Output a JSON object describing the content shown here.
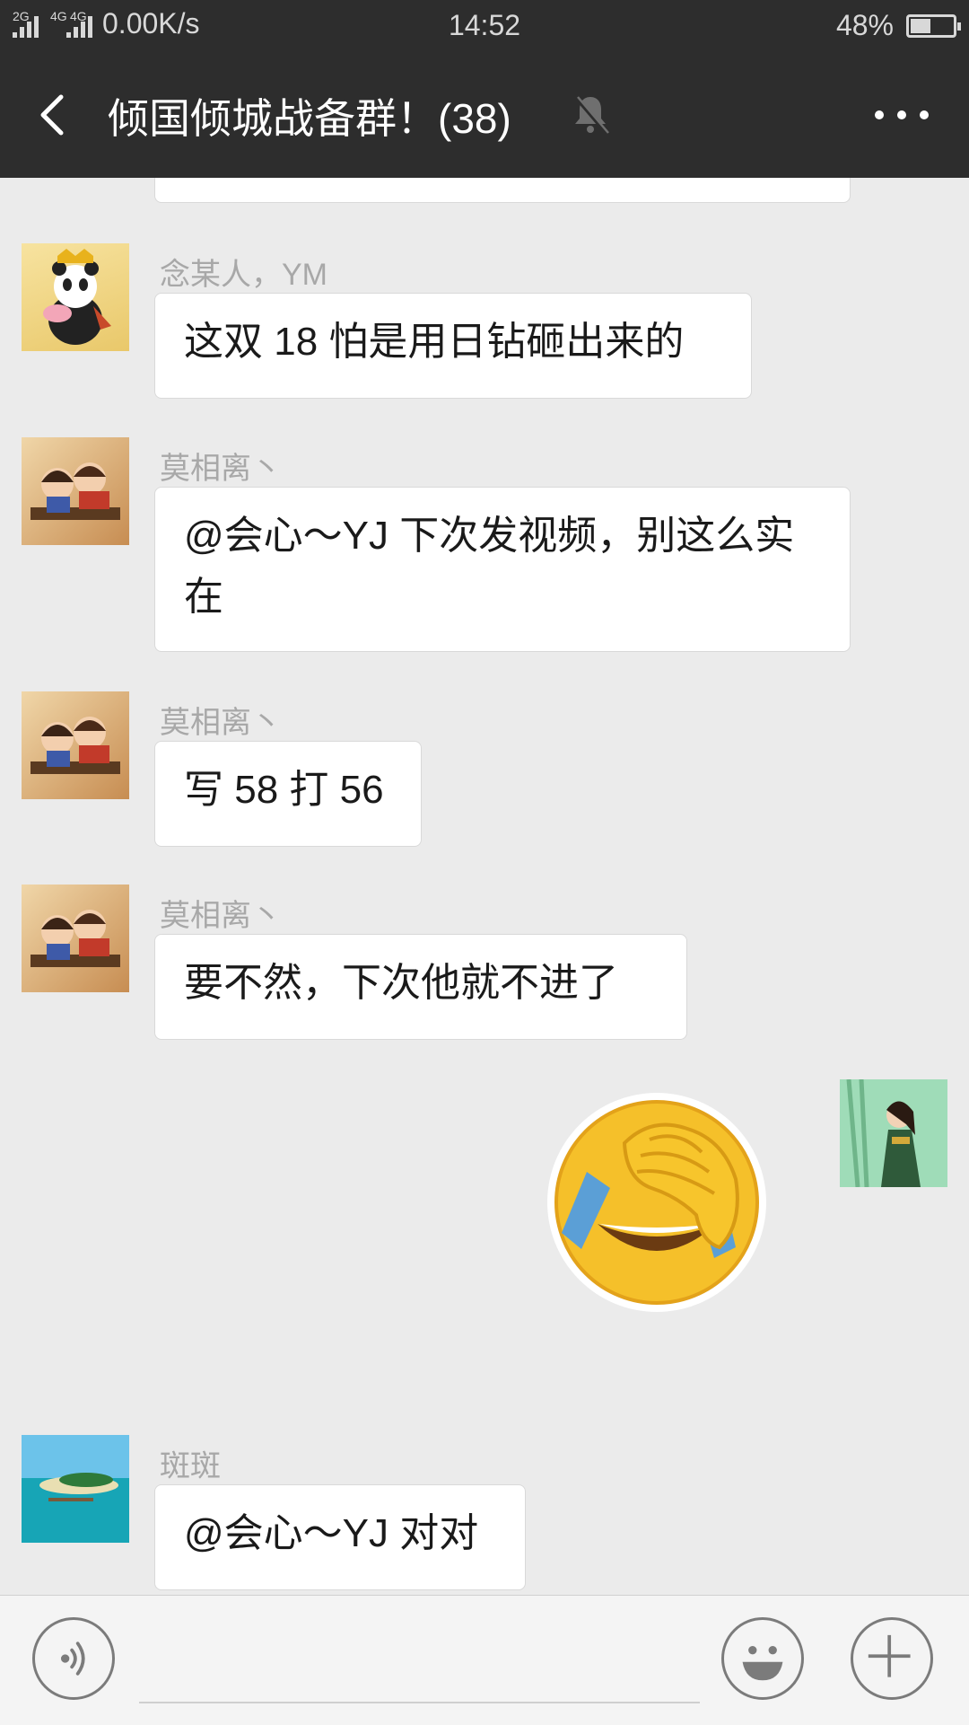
{
  "status": {
    "signal_labels": [
      "2G",
      "4G",
      "4G"
    ],
    "speed": "0.00K/s",
    "time": "14:52",
    "battery": "48%",
    "battery_level": 0.48
  },
  "header": {
    "title": "倾国倾城战备群！(38)",
    "muted": true
  },
  "messages": [
    {
      "sender": "念某人，YM",
      "avatar": "panda",
      "text": "这双 18 怕是用日钻砸出来的"
    },
    {
      "sender": "莫相离丶",
      "avatar": "kids",
      "text": "@会心～YJ 下次发视频，别这么实在"
    },
    {
      "sender": "莫相离丶",
      "avatar": "kids",
      "text": "写 58 打 56"
    },
    {
      "sender": "莫相离丶",
      "avatar": "kids",
      "text": "要不然，下次他就不进了"
    },
    {
      "sender": "self",
      "avatar": "girl",
      "sticker": "facepalm-emoji"
    },
    {
      "sender": "斑斑",
      "avatar": "beach",
      "text": "@会心～YJ 对对"
    }
  ],
  "colors": {
    "header_bg": "#2d2d2d",
    "chat_bg": "#ebebeb",
    "bubble_bg": "#ffffff",
    "sender_name": "#a8a8a8"
  }
}
